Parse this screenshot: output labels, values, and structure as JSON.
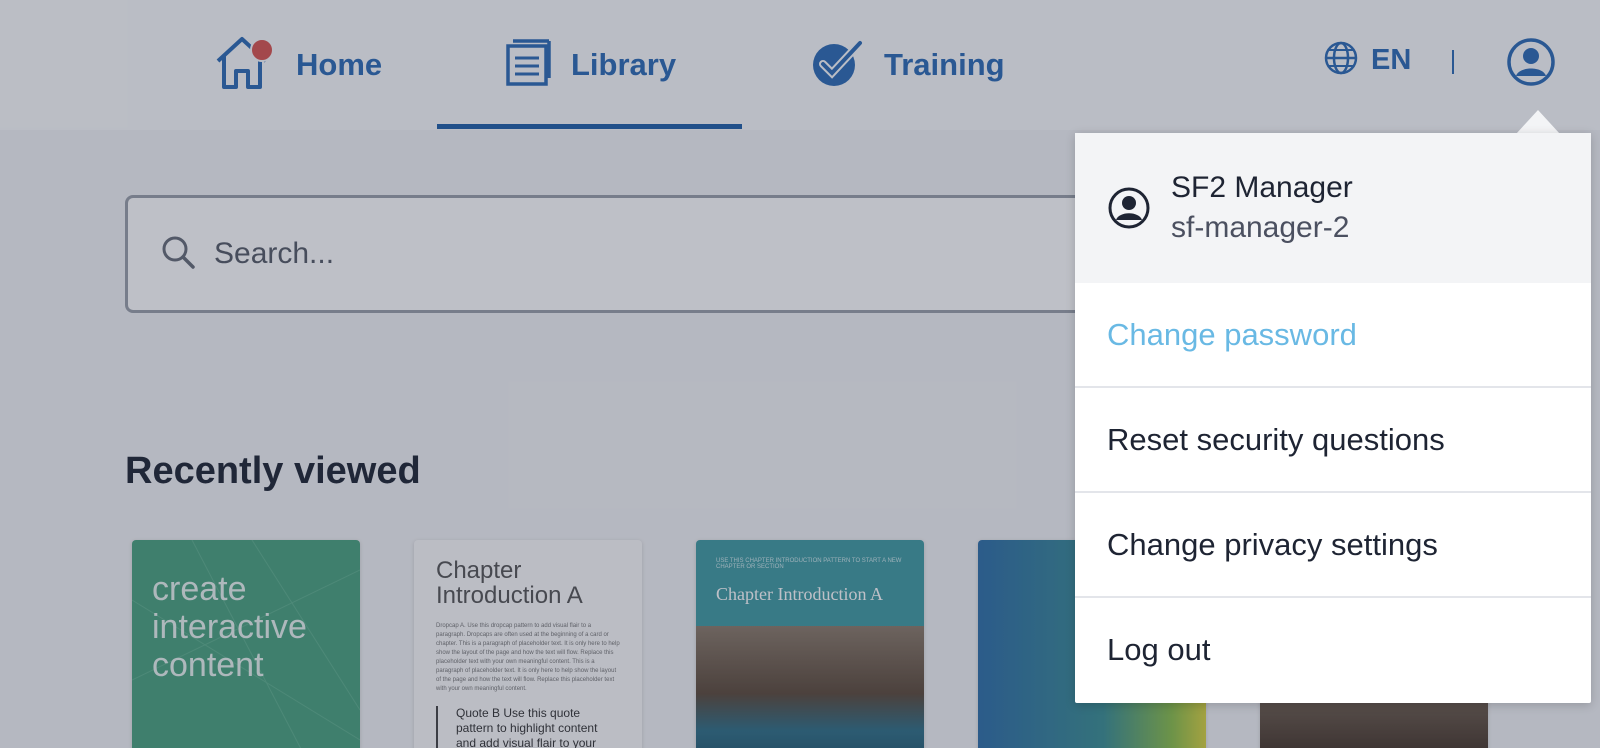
{
  "nav": {
    "home": "Home",
    "library": "Library",
    "training": "Training",
    "language": "EN"
  },
  "search": {
    "placeholder": "Search..."
  },
  "recently_viewed": {
    "title": "Recently viewed",
    "cards": [
      {
        "text": "create interactive content"
      },
      {
        "title": "Chapter Introduction A",
        "body": "Dropcap A. Use this dropcap pattern to add visual flair to a paragraph. Dropcaps are often used at the beginning of a card or chapter. This is a paragraph of placeholder text. It is only here to help show the layout of the page and how the text will flow. Replace this placeholder text with your own meaningful content. This is a paragraph of placeholder text. It is only here to help show the layout of the page and how the text will flow. Replace this placeholder text with your own meaningful content.",
        "quote": "Quote B Use this quote pattern to highlight content and add visual flair to your layout."
      },
      {
        "small": "USE THIS CHAPTER INTRODUCTION PATTERN TO START A NEW CHAPTER OR SECTION",
        "title": "Chapter Introduction A"
      },
      {},
      {}
    ]
  },
  "user_menu": {
    "name": "SF2 Manager",
    "username": "sf-manager-2",
    "items": [
      "Change password",
      "Reset security questions",
      "Change privacy settings",
      "Log out"
    ]
  },
  "colors": {
    "brand_blue": "#2c6bb5",
    "active_link": "#69b9e4",
    "notification_dot": "#d9534f"
  }
}
